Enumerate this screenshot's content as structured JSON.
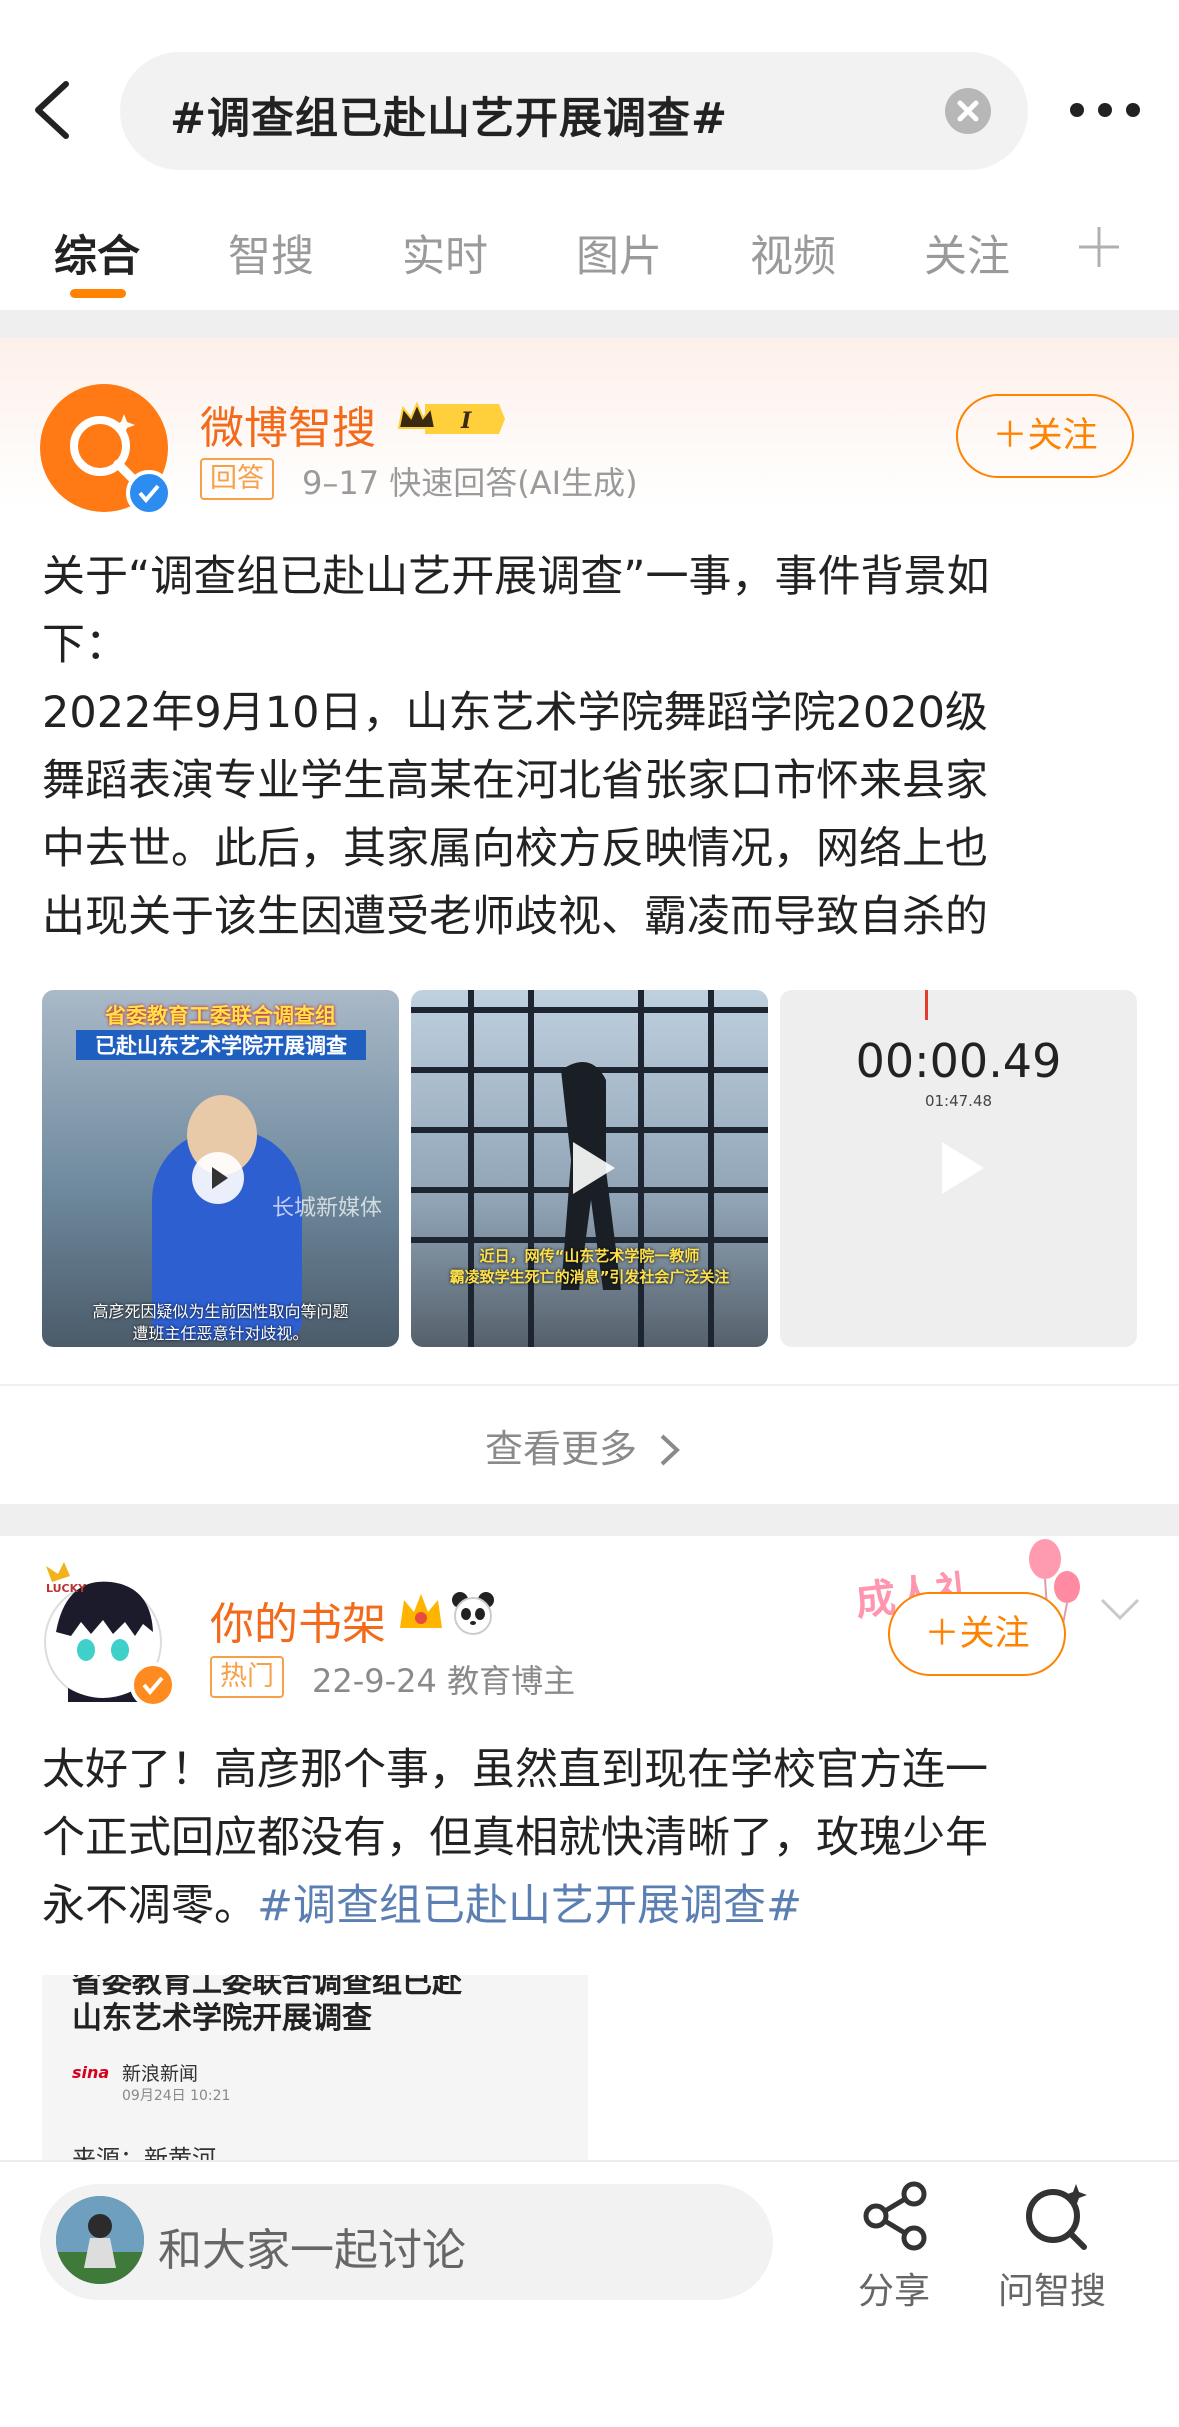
{
  "search": {
    "query": "#调查组已赴山艺开展调查#"
  },
  "tabs": [
    "综合",
    "智搜",
    "实时",
    "图片",
    "视频",
    "关注"
  ],
  "card1": {
    "author": "微博智搜",
    "badge_level": "I",
    "tag": "回答",
    "meta": "9–17  快速回答(AI生成)",
    "follow_label": "＋关注",
    "text_line1": "关于“调查组已赴山艺开展调查”一事，事件背景如",
    "text_line2": "下：",
    "text_line3": "2022年9月10日，山东艺术学院舞蹈学院2020级",
    "text_line4": "舞蹈表演专业学生高某在河北省张家口市怀来县家",
    "text_line5": "中去世。此后，其家属向校方反映情况，网络上也",
    "text_line6": "出现关于该生因遭受老师歧视、霸凌而导致自杀的",
    "thumb1": {
      "caption_top1": "省委教育工委联合调查组",
      "caption_top2": "已赴山东艺术学院开展调查",
      "watermark": "长城新媒体",
      "caption_bottom1": "高彦死因疑似为生前因性取向等问题",
      "caption_bottom2": "遭班主任恶意针对歧视。"
    },
    "thumb2": {
      "caption1": "近日，网传“山东艺术学院一教师",
      "caption2": "霸凌致学生死亡的消息”引发社会广泛关注"
    },
    "thumb3": {
      "timer": "00:00.49",
      "subtimer": "01:47.48"
    },
    "more_label": "查看更多",
    "colors": {
      "accent": "#ff8200",
      "name": "#f26a1a",
      "verified": "#2d8cf0"
    }
  },
  "card2": {
    "author": "你的书架",
    "tag": "热门",
    "meta": "22-9-24  教育博主",
    "follow_label": "＋关注",
    "decoration": "成人礼",
    "avatar_badge": "LUCKY",
    "text_line1": "太好了！高彦那个事，虽然直到现在学校官方连一",
    "text_line2": "个正式回应都没有，但真相就快清晰了，玫瑰少年",
    "text_line3_pre": "永不凋零。",
    "text_line3_link": "#调查组已赴山艺开展调查#",
    "news": {
      "title_partial": "省委教育工委联合调查组已赴",
      "title": "山东艺术学院开展调查",
      "logo": "sina",
      "source": "新浪新闻",
      "time": "09月24日 10:21",
      "origin": "来源：新黄河"
    }
  },
  "bottom": {
    "comment_placeholder": "和大家一起讨论",
    "share": "分享",
    "ask": "问智搜"
  }
}
